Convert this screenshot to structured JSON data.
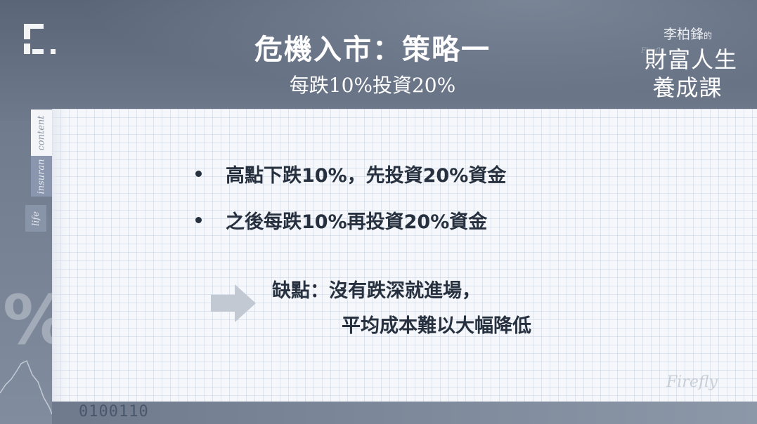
{
  "header": {
    "title": "危機入市：策略一",
    "subtitle": "每跌10%投資20%"
  },
  "brand": {
    "name_small": "李柏鋒",
    "name_small_suffix": "的",
    "course_line1": "財富人生",
    "course_line2": "養成課",
    "script": "Firefly"
  },
  "side_tabs": {
    "content": "content",
    "insurance": "insuran",
    "life": "life"
  },
  "content": {
    "bullets": [
      "高點下跌10%，先投資20%資金",
      "之後每跌10%再投資20%資金"
    ],
    "note_line1": "缺點：沒有跌深就進場，",
    "note_line2": "平均成本難以大幅降低"
  },
  "decor": {
    "percent_symbol": "%",
    "binary": "0100110",
    "watermark": "Firefly"
  },
  "colors": {
    "text_dark": "#26303e",
    "background": "#6f7b8d",
    "card": "#f5f7fa",
    "arrow": "#c3c9d3"
  }
}
